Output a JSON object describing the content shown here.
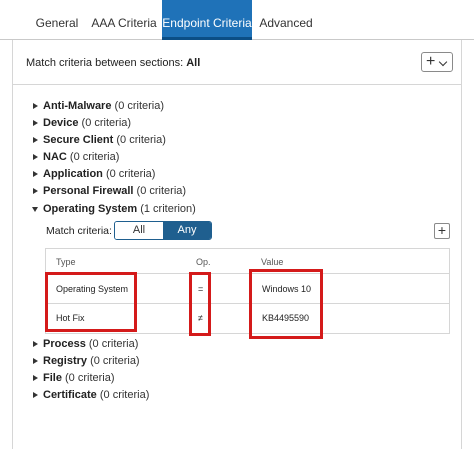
{
  "tabs": [
    {
      "label": "General",
      "active": false
    },
    {
      "label": "AAA Criteria",
      "active": false
    },
    {
      "label": "Endpoint Criteria",
      "active": true
    },
    {
      "label": "Advanced",
      "active": false
    }
  ],
  "match_bar": {
    "label": "Match criteria between sections:",
    "value": "All",
    "add_icon": "plus-icon",
    "dropdown_icon": "chevron-down-icon"
  },
  "sections": [
    {
      "name": "Anti-Malware",
      "count": "(0 criteria)",
      "expanded": false
    },
    {
      "name": "Device",
      "count": "(0 criteria)",
      "expanded": false
    },
    {
      "name": "Secure Client",
      "count": "(0 criteria)",
      "expanded": false
    },
    {
      "name": "NAC",
      "count": "(0 criteria)",
      "expanded": false
    },
    {
      "name": "Application",
      "count": "(0 criteria)",
      "expanded": false
    },
    {
      "name": "Personal Firewall",
      "count": "(0 criteria)",
      "expanded": false
    },
    {
      "name": "Operating System",
      "count": "(1 criterion)",
      "expanded": true
    },
    {
      "name": "Process",
      "count": "(0 criteria)",
      "expanded": false
    },
    {
      "name": "Registry",
      "count": "(0 criteria)",
      "expanded": false
    },
    {
      "name": "File",
      "count": "(0 criteria)",
      "expanded": false
    },
    {
      "name": "Certificate",
      "count": "(0 criteria)",
      "expanded": false
    }
  ],
  "os_section": {
    "match_label": "Match criteria:",
    "options": [
      "All",
      "Any"
    ],
    "selected": "Any",
    "columns": [
      "Type",
      "Op.",
      "Value"
    ],
    "rows": [
      {
        "type": "Operating System",
        "op": "=",
        "value": "Windows 10"
      },
      {
        "type": "Hot Fix",
        "op": "≠",
        "value": "KB4495590"
      }
    ]
  },
  "colors": {
    "accent": "#1f72b8",
    "segment_selected": "#1f5f8f",
    "highlight": "#d41a1a"
  }
}
